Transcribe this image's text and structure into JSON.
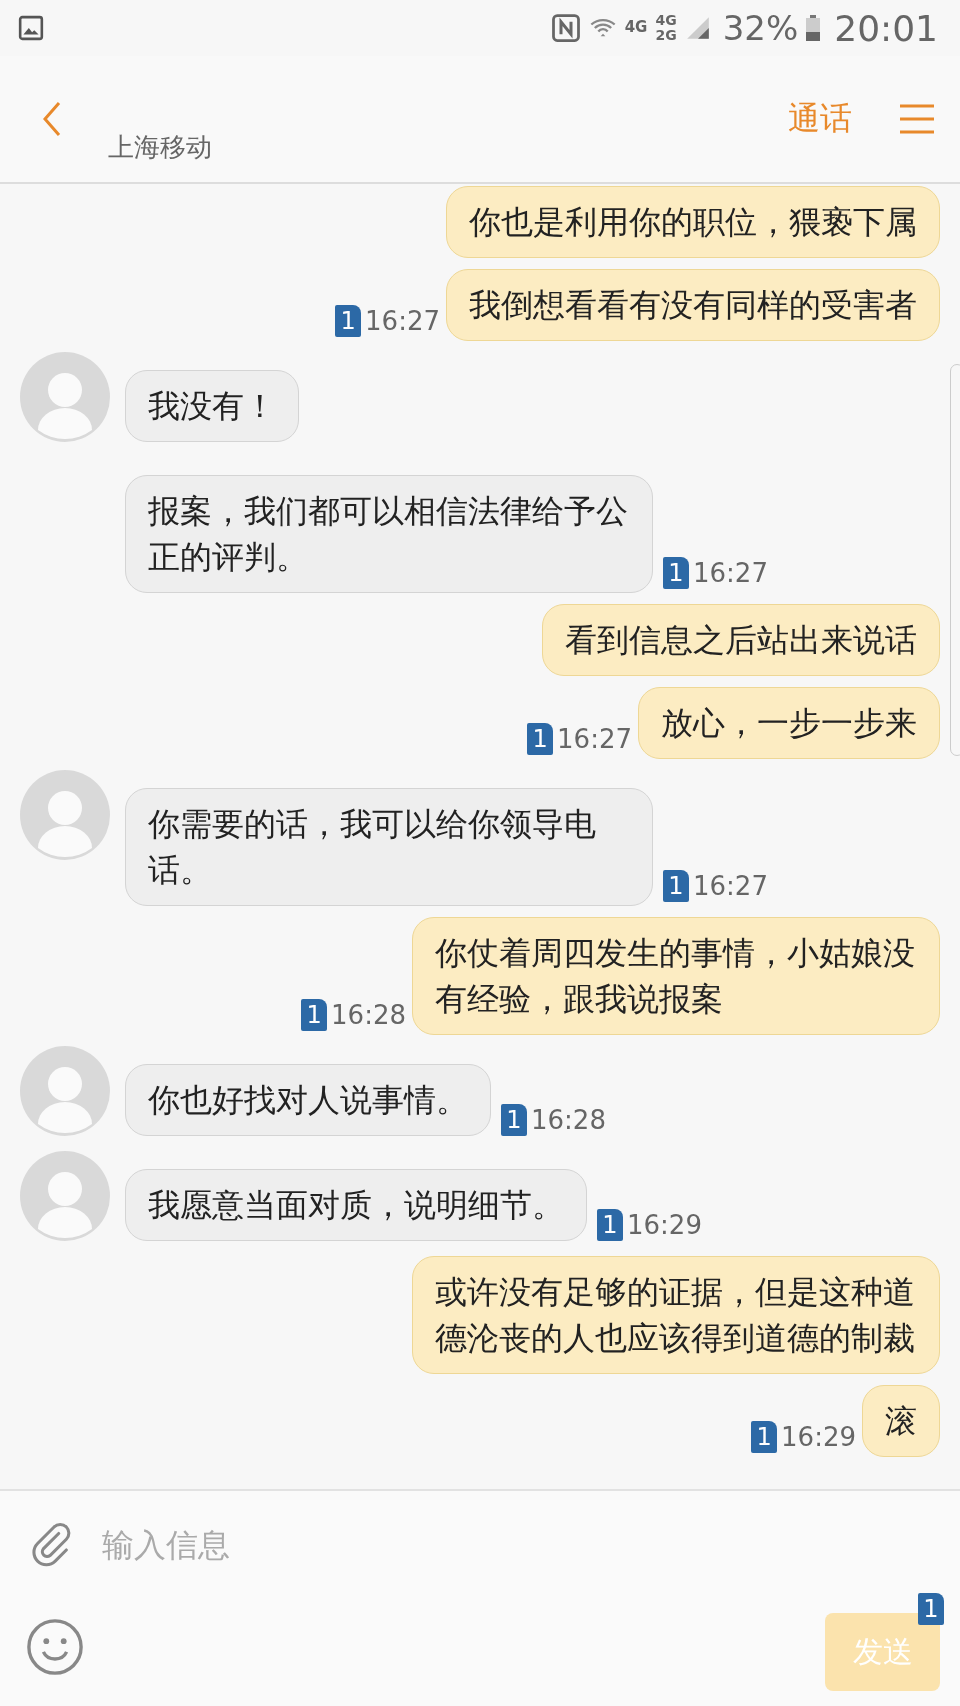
{
  "status_bar": {
    "network_a": "4G",
    "network_b_top": "4G",
    "network_b_bottom": "2G",
    "battery": "32%",
    "time": "20:01"
  },
  "header": {
    "subtitle": "上海移动",
    "call": "通话"
  },
  "messages": [
    {
      "kind": "out",
      "text": "你也是利用你的职位，猥亵下属",
      "avatar": false
    },
    {
      "kind": "out",
      "text": "我倒想看看有没有同样的受害者",
      "time": "16:27",
      "sim": "1",
      "avatar": false
    },
    {
      "kind": "in",
      "text": "我没有！",
      "avatar": true
    },
    {
      "kind": "in",
      "text": "报案，我们都可以相信法律给予公正的评判。",
      "time": "16:27",
      "sim": "1",
      "avatar": false
    },
    {
      "kind": "out",
      "text": "看到信息之后站出来说话",
      "avatar": false
    },
    {
      "kind": "out",
      "text": "放心，一步一步来",
      "time": "16:27",
      "sim": "1",
      "avatar": false
    },
    {
      "kind": "in",
      "text": "你需要的话，我可以给你领导电话。",
      "time": "16:27",
      "sim": "1",
      "avatar": true
    },
    {
      "kind": "out",
      "text": "你仗着周四发生的事情，小姑娘没有经验，跟我说报案",
      "time": "16:28",
      "sim": "1",
      "avatar": false
    },
    {
      "kind": "in",
      "text": "你也好找对人说事情。",
      "time": "16:28",
      "sim": "1",
      "avatar": true
    },
    {
      "kind": "in",
      "text": "我愿意当面对质，说明细节。",
      "time": "16:29",
      "sim": "1",
      "avatar": true
    },
    {
      "kind": "out",
      "text": "或许没有足够的证据，但是这种道德沦丧的人也应该得到道德的制裁",
      "avatar": false
    },
    {
      "kind": "out",
      "text": "滚",
      "time": "16:29",
      "sim": "1",
      "avatar": false
    }
  ],
  "composer": {
    "placeholder": "输入信息",
    "send": "发送",
    "send_sim": "1"
  }
}
